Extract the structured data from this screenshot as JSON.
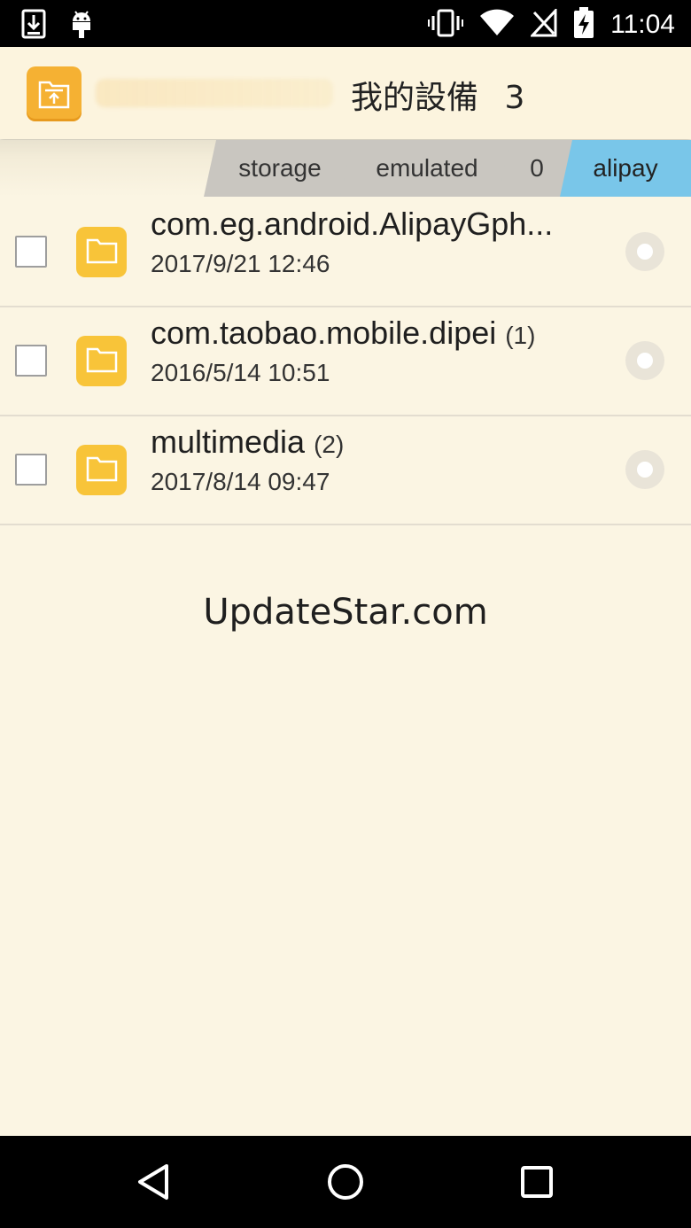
{
  "status_bar": {
    "time": "11:04",
    "icons": [
      "download-icon",
      "android-icon",
      "vibrate-icon",
      "wifi-icon",
      "no-sim-icon",
      "battery-charging-icon"
    ]
  },
  "header": {
    "logo_icon": "file-upload-icon",
    "title": "我的設備",
    "count": "3"
  },
  "breadcrumb": {
    "items": [
      {
        "label": "storage"
      },
      {
        "label": "emulated"
      },
      {
        "label": "0"
      },
      {
        "label": "alipay"
      }
    ],
    "active_color": "#79c6e9"
  },
  "files": [
    {
      "name": "com.eg.android.AlipayGph...",
      "count": "",
      "date": "2017/9/21 12:46"
    },
    {
      "name": "com.taobao.mobile.dipei",
      "count": "(1)",
      "date": "2016/5/14 10:51"
    },
    {
      "name": "multimedia",
      "count": "(2)",
      "date": "2017/8/14 09:47"
    }
  ],
  "watermark": "UpdateStar.com",
  "nav_bar": {
    "icons": [
      "back-icon",
      "home-icon",
      "recents-icon"
    ]
  },
  "colors": {
    "background": "#fbf5e3",
    "folder": "#f8c439",
    "logo": "#f5b133"
  }
}
